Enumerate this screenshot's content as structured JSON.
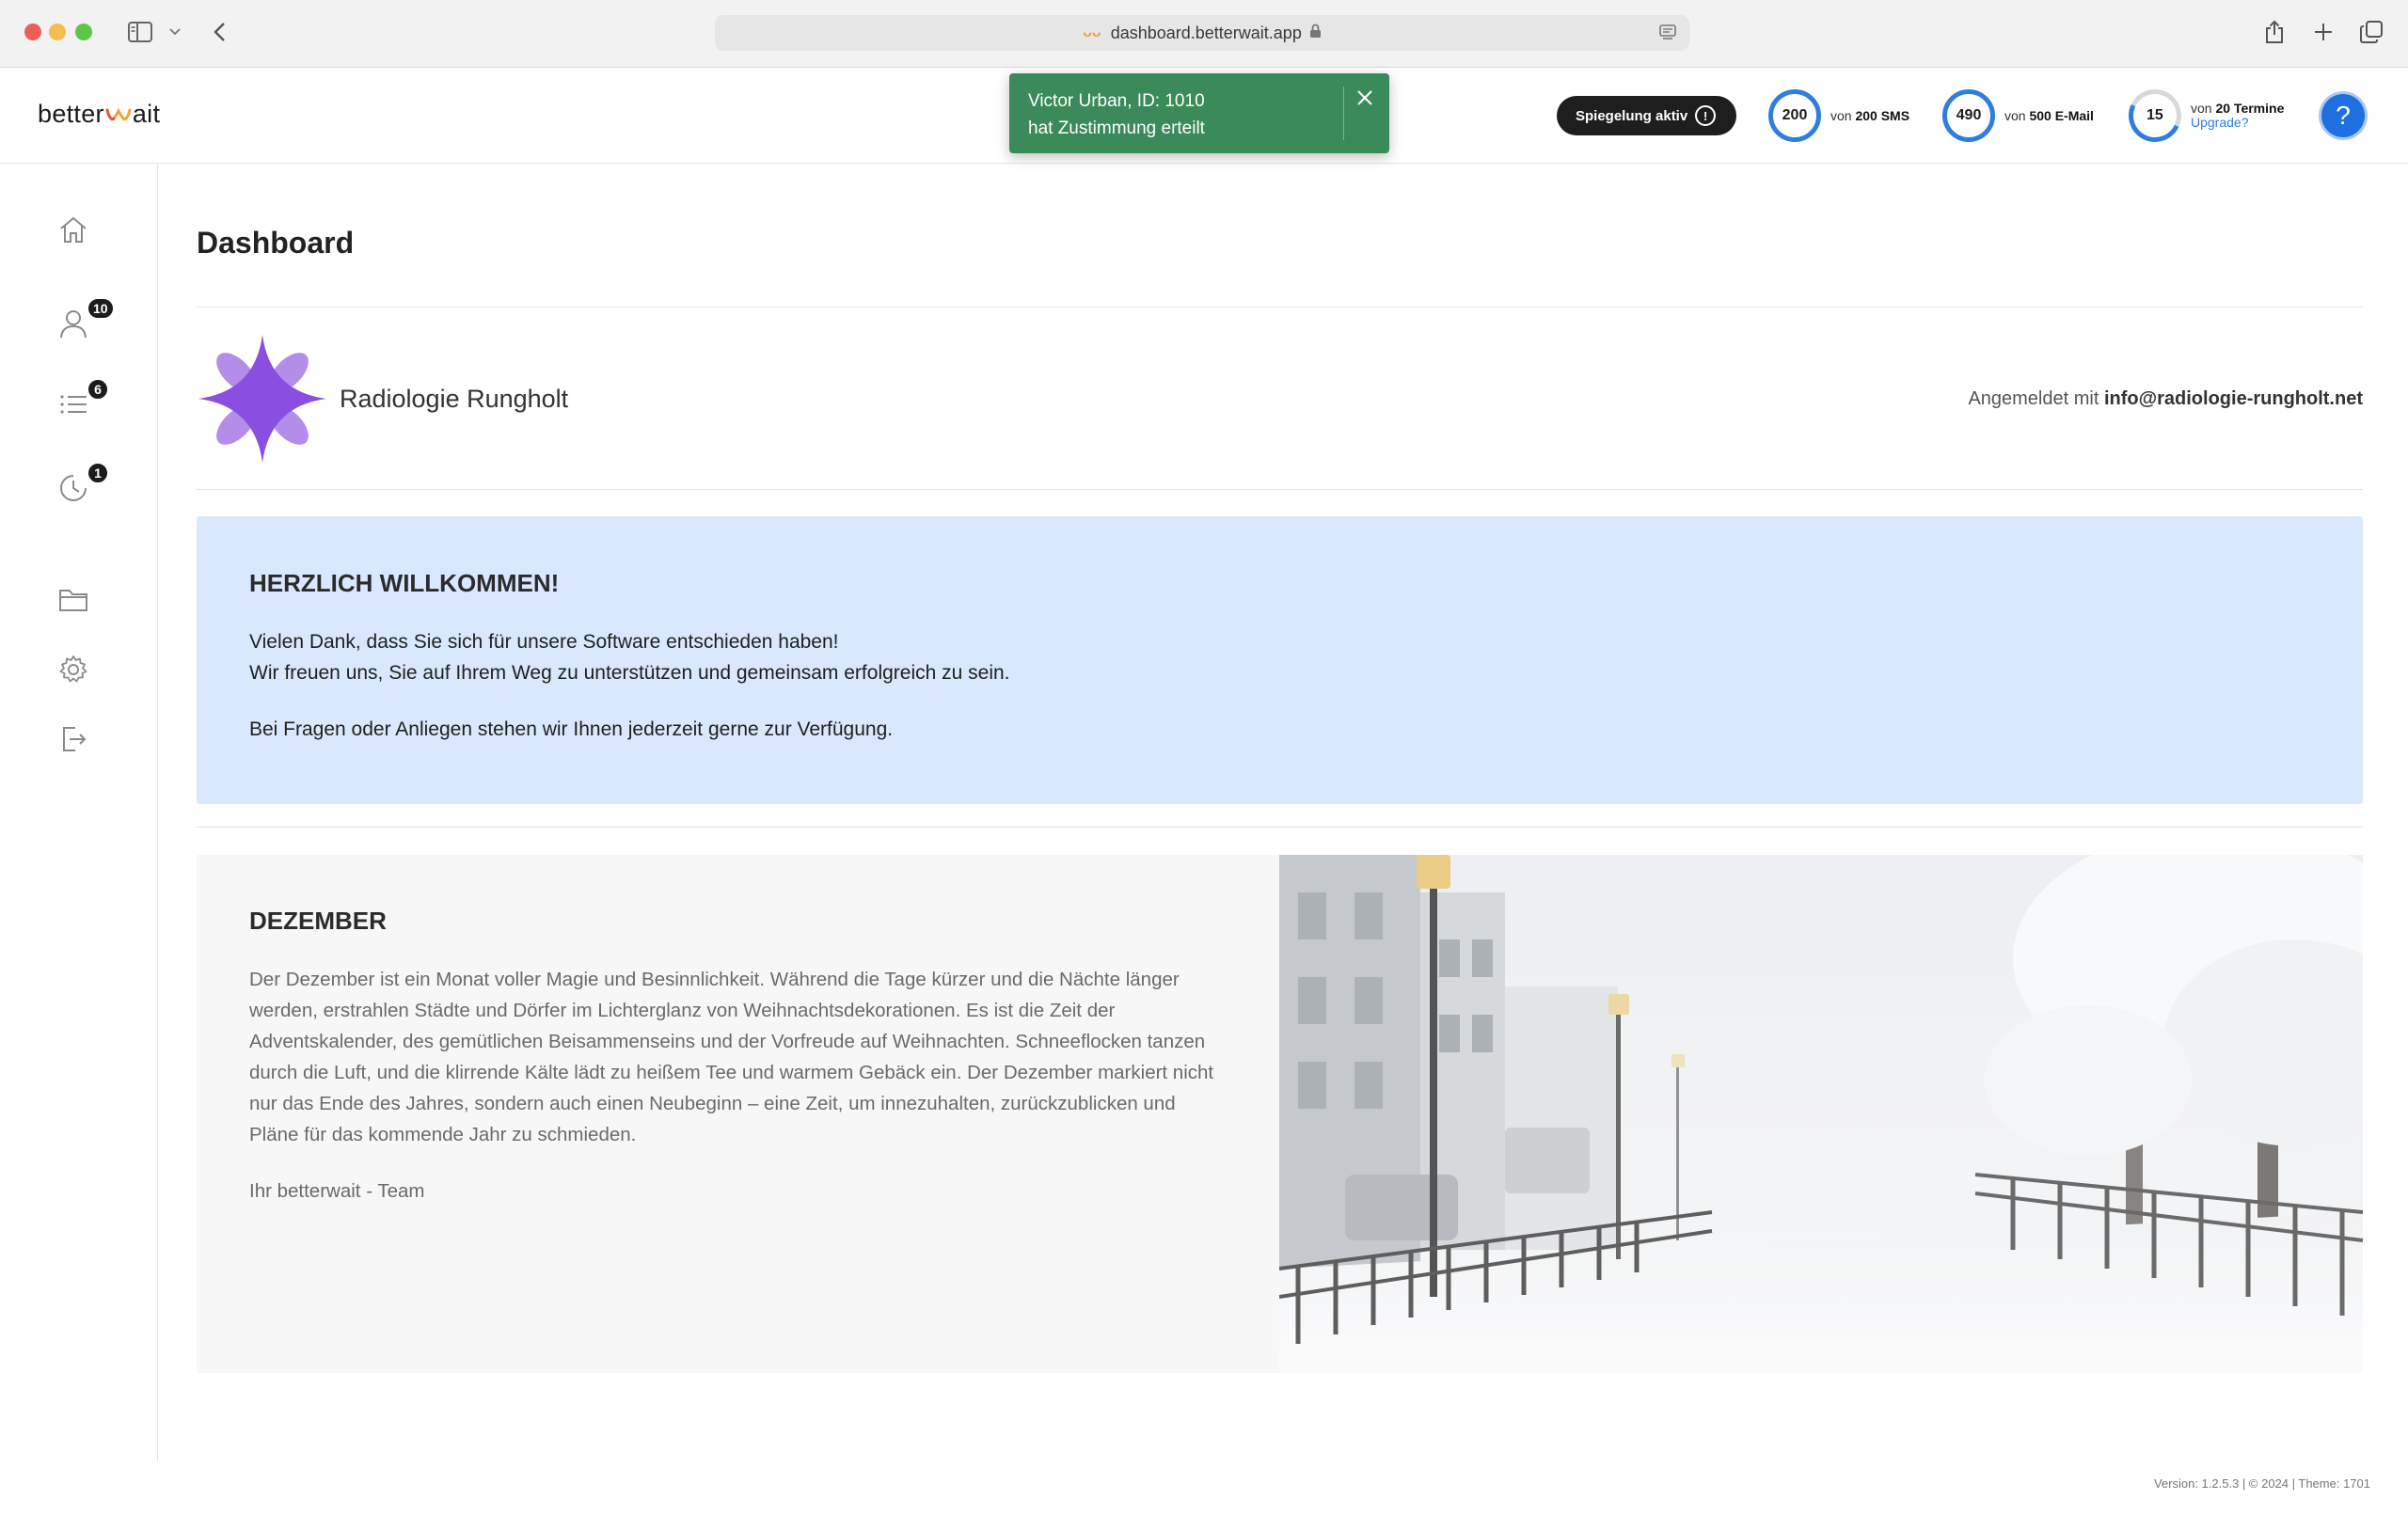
{
  "browser": {
    "url": "dashboard.betterwait.app"
  },
  "header": {
    "logo_text_left": "better",
    "logo_text_right": "ait",
    "mirror_label": "Spiegelung aktiv",
    "quotas": [
      {
        "value": "200",
        "prefix": "von",
        "limit": "200 SMS",
        "fraction": 1.0
      },
      {
        "value": "490",
        "prefix": "von",
        "limit": "500 E-Mail",
        "fraction": 0.98
      },
      {
        "value": "15",
        "prefix": "von",
        "limit": "20 Termine",
        "link": "Upgrade?",
        "fraction": 0.75
      }
    ],
    "help_label": "?"
  },
  "toast": {
    "line1": "Victor Urban, ID: 1010",
    "line2": "hat Zustimmung erteilt",
    "color": "#3a8a5a"
  },
  "sidebar": {
    "items": [
      {
        "name": "home",
        "icon": "home-icon"
      },
      {
        "name": "patients",
        "icon": "user-icon",
        "badge": "10"
      },
      {
        "name": "lists",
        "icon": "list-icon",
        "badge": "6"
      },
      {
        "name": "history",
        "icon": "clock-icon",
        "badge": "1"
      },
      {
        "name": "files",
        "icon": "folder-icon"
      },
      {
        "name": "settings",
        "icon": "gear-icon"
      },
      {
        "name": "logout",
        "icon": "logout-icon"
      }
    ]
  },
  "main": {
    "title": "Dashboard",
    "org_name": "Radiologie Rungholt",
    "login_prefix": "Angemeldet mit",
    "login_email": "info@radiologie-rungholt.net",
    "welcome": {
      "heading": "HERZLICH WILLKOMMEN!",
      "line1": "Vielen Dank, dass Sie sich für unsere Software entschieden haben!",
      "line2": "Wir freuen uns, Sie auf Ihrem Weg zu unterstützen und gemeinsam erfolgreich zu sein.",
      "line3": "Bei Fragen oder Anliegen stehen wir Ihnen jederzeit gerne zur Verfügung."
    },
    "month": {
      "heading": "DEZEMBER",
      "body": "Der Dezember ist ein Monat voller Magie und Besinnlichkeit. Während die Tage kürzer und die Nächte länger werden, erstrahlen Städte und Dörfer im Lichterglanz von Weihnachtsdekorationen. Es ist die Zeit der Adventskalender, des gemütlichen Beisammenseins und der Vorfreude auf Weihnachten. Schneeflocken tanzen durch die Luft, und die klirrende Kälte lädt zu heißem Tee und warmem Gebäck ein. Der Dezember markiert nicht nur das Ende des Jahres, sondern auch einen Neubeginn – eine Zeit, um innezuhalten, zurückzublicken und Pläne für das kommende Jahr zu schmieden.",
      "signature": "Ihr betterwait - Team"
    }
  },
  "footer": {
    "version": "Version: 1.2.5.3 | © 2024 | Theme: 1701"
  }
}
